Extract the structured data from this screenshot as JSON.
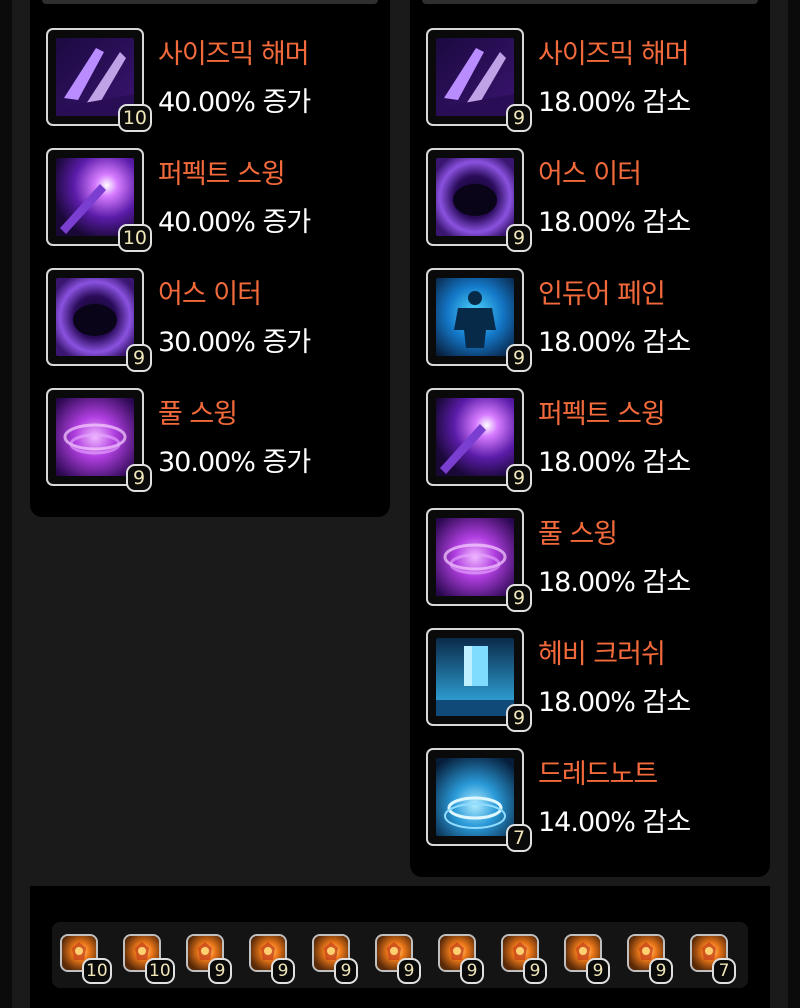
{
  "left_panel": {
    "skills": [
      {
        "name": "사이즈믹 해머",
        "value": "40.00% 증가",
        "level": "10",
        "icon": "seismic-hammer-icon"
      },
      {
        "name": "퍼펙트 스윙",
        "value": "40.00% 증가",
        "level": "10",
        "icon": "perfect-swing-icon"
      },
      {
        "name": "어스 이터",
        "value": "30.00% 증가",
        "level": "9",
        "icon": "earth-eater-icon"
      },
      {
        "name": "풀 스윙",
        "value": "30.00% 증가",
        "level": "9",
        "icon": "full-swing-icon"
      }
    ]
  },
  "right_panel": {
    "skills": [
      {
        "name": "사이즈믹 해머",
        "value": "18.00% 감소",
        "level": "9",
        "icon": "seismic-hammer-icon"
      },
      {
        "name": "어스 이터",
        "value": "18.00% 감소",
        "level": "9",
        "icon": "earth-eater-icon"
      },
      {
        "name": "인듀어 페인",
        "value": "18.00% 감소",
        "level": "9",
        "icon": "endure-pain-icon"
      },
      {
        "name": "퍼펙트 스윙",
        "value": "18.00% 감소",
        "level": "9",
        "icon": "perfect-swing-icon"
      },
      {
        "name": "풀 스윙",
        "value": "18.00% 감소",
        "level": "9",
        "icon": "full-swing-icon"
      },
      {
        "name": "헤비 크러쉬",
        "value": "18.00% 감소",
        "level": "9",
        "icon": "heavy-crush-icon"
      },
      {
        "name": "드레드노트",
        "value": "14.00% 감소",
        "level": "7",
        "icon": "dreadnought-icon"
      }
    ]
  },
  "gems": [
    {
      "level": "10",
      "icon": "gem-icon"
    },
    {
      "level": "10",
      "icon": "gem-icon"
    },
    {
      "level": "9",
      "icon": "gem-icon"
    },
    {
      "level": "9",
      "icon": "gem-icon"
    },
    {
      "level": "9",
      "icon": "gem-icon"
    },
    {
      "level": "9",
      "icon": "gem-icon"
    },
    {
      "level": "9",
      "icon": "gem-icon"
    },
    {
      "level": "9",
      "icon": "gem-icon"
    },
    {
      "level": "9",
      "icon": "gem-icon"
    },
    {
      "level": "9",
      "icon": "gem-icon"
    },
    {
      "level": "7",
      "icon": "gem-icon"
    }
  ],
  "colors": {
    "skill_name": "#f26a3b",
    "value_text": "#ffffff",
    "level_text": "#f0e6b8"
  }
}
